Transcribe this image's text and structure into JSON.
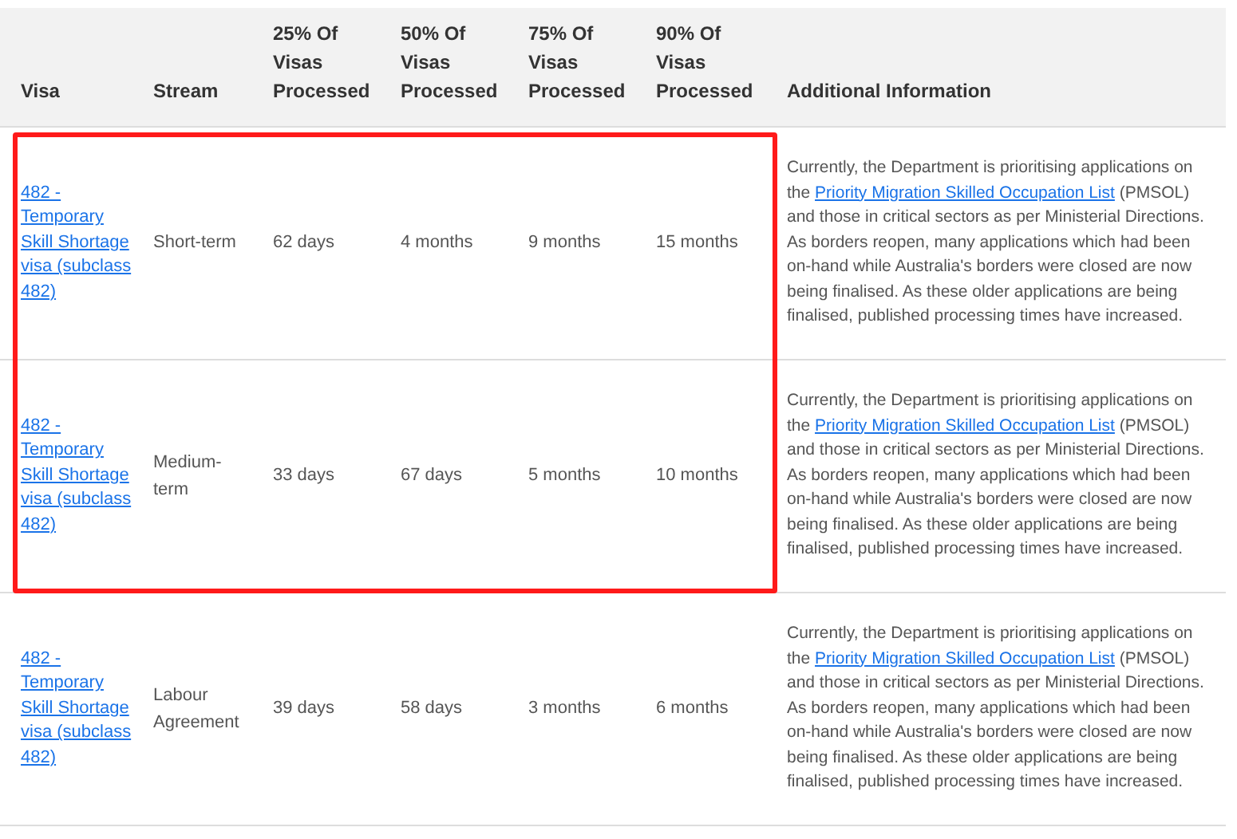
{
  "table": {
    "columns": [
      "Visa",
      "Stream",
      "25% Of Visas Processed",
      "50% Of Visas Processed",
      "75% Of Visas Processed",
      "90% Of Visas Processed",
      "Additional Information"
    ],
    "rows": [
      {
        "highlighted": true,
        "visa": "482 - Temporary Skill Shortage visa (subclass 482)",
        "stream": "Short-term",
        "p25": "62 days",
        "p50": "4 months",
        "p75": "9 months",
        "p90": "15 months",
        "info": {
          "before": "Currently, the Department is prioritising applications on the ",
          "link": "Priority Migration Skilled Occupation List",
          "after": " (PMSOL) and those in critical sectors as per Ministerial Directions.  As borders reopen, many applications which had been on-hand while Australia's borders were closed are now being finalised. As these older applications are being finalised, published processing times have increased."
        }
      },
      {
        "highlighted": true,
        "visa": "482 - Temporary Skill Shortage visa (subclass 482)",
        "stream": "Medium-term",
        "p25": "33 days",
        "p50": "67 days",
        "p75": "5 months",
        "p90": "10 months",
        "info": {
          "before": "Currently, the Department is prioritising applications on the ",
          "link": "Priority Migration Skilled Occupation List",
          "after": " (PMSOL) and those in critical sectors as per Ministerial Directions.  As borders reopen, many applications which had been on-hand while Australia's borders were closed are now being finalised. As these older applications are being finalised, published processing times have increased."
        }
      },
      {
        "highlighted": false,
        "visa": "482 - Temporary Skill Shortage visa (subclass 482)",
        "stream": "Labour Agreement",
        "p25": "39 days",
        "p50": "58 days",
        "p75": "3 months",
        "p90": "6 months",
        "info": {
          "before": "Currently, the Department is prioritising applications on the ",
          "link": "Priority Migration Skilled Occupation List",
          "after": " (PMSOL) and those in critical sectors as per Ministerial Directions.  As borders reopen, many applications which had been on-hand while Australia's borders were closed are now being finalised. As these older applications are being finalised, published processing times have increased."
        }
      }
    ]
  }
}
